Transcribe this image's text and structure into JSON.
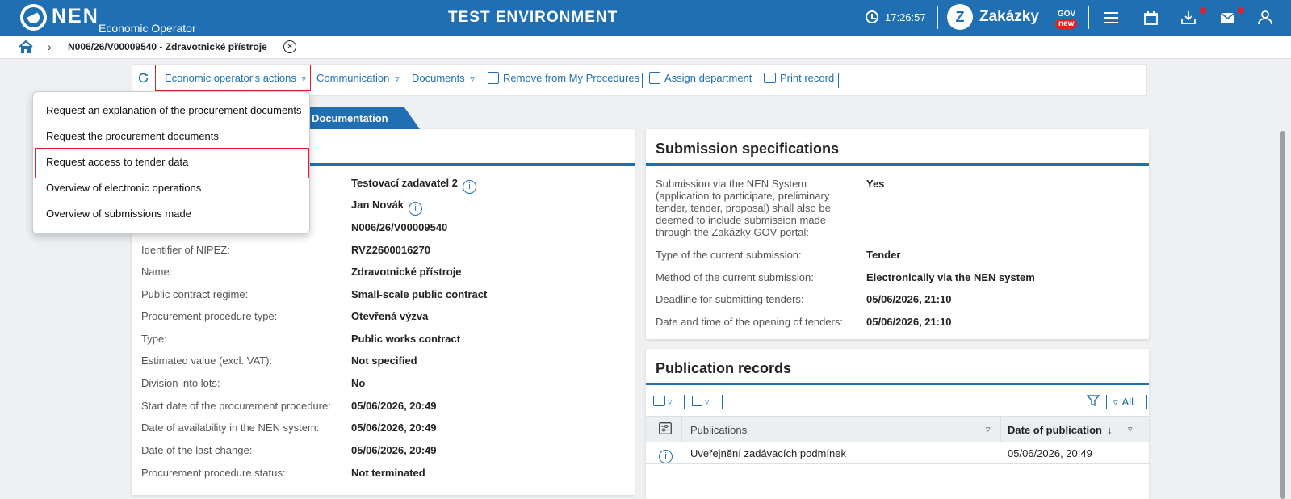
{
  "header": {
    "logo_text": "NEN",
    "logo_sub": "Economic Operator",
    "env_title": "TEST ENVIRONMENT",
    "time": "17:26:57",
    "zakazky": "Zakázky",
    "gov": "GOV",
    "new_badge": "new",
    "icons": [
      "clock-icon",
      "menu-icon",
      "calendar-icon",
      "download-icon",
      "mail-icon",
      "user-icon"
    ]
  },
  "breadcrumb": {
    "record": "N006/26/V00009540 - Zdravotnické přístroje"
  },
  "toolbar": {
    "actions": "Economic operator's actions",
    "communication": "Communication",
    "documents": "Documents",
    "remove": "Remove from My Procedures",
    "assign": "Assign department",
    "print": "Print record",
    "chevron": "▿"
  },
  "tab": {
    "label": "Documentation"
  },
  "dropdown": {
    "items": [
      "Request an explanation of the procurement documents",
      "Request the procurement documents",
      "Request access to tender data",
      "Overview of electronic operations",
      "Overview of submissions made"
    ]
  },
  "details": {
    "contracting_authority": "Testovací zadavatel 2",
    "contact": "Jan Novák",
    "system_number": "N006/26/V00009540",
    "rows": [
      {
        "label": "Identifier of NIPEZ:",
        "value": "RVZ2600016270"
      },
      {
        "label": "Name:",
        "value": "Zdravotnické přístroje"
      },
      {
        "label": "Public contract regime:",
        "value": "Small-scale public contract"
      },
      {
        "label": "Procurement procedure type:",
        "value": "Otevřená výzva"
      },
      {
        "label": "Type:",
        "value": "Public works contract"
      },
      {
        "label": "Estimated value (excl. VAT):",
        "value": "Not specified"
      },
      {
        "label": "Division into lots:",
        "value": "No"
      },
      {
        "label": "Start date of the procurement procedure:",
        "value": "05/06/2026, 20:49"
      },
      {
        "label": "Date of availability in the NEN system:",
        "value": "05/06/2026, 20:49"
      },
      {
        "label": "Date of the last change:",
        "value": "05/06/2026, 20:49"
      },
      {
        "label": "Procurement procedure status:",
        "value": "Not terminated"
      }
    ]
  },
  "submission": {
    "title": "Submission specifications",
    "rows": [
      {
        "label": "Submission via the NEN System (application to participate, preliminary tender, tender, proposal) shall also be deemed to include submission made through the Zakázky GOV portal:",
        "value": "Yes"
      },
      {
        "label": "Type of the current submission:",
        "value": "Tender"
      },
      {
        "label": "Method of the current submission:",
        "value": "Electronically via the NEN system"
      },
      {
        "label": "Deadline for submitting tenders:",
        "value": "05/06/2026, 21:10"
      },
      {
        "label": "Date and time of the opening of tenders:",
        "value": "05/06/2026, 21:10"
      }
    ]
  },
  "publication": {
    "title": "Publication records",
    "filter_all": "All",
    "col_publications": "Publications",
    "col_date": "Date of publication",
    "rows": [
      {
        "name": "Uveřejnění zadávacích podmínek",
        "date": "05/06/2026, 20:49"
      }
    ]
  }
}
